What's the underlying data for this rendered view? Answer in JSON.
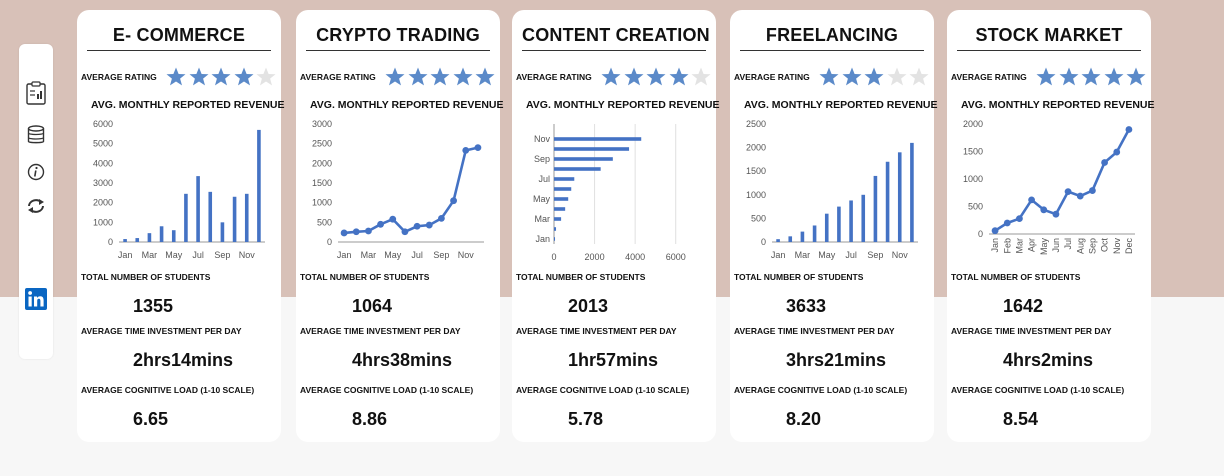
{
  "colors": {
    "accent": "#4472c4",
    "star_filled": "#5b8ac9",
    "star_empty": "#e3e3e3",
    "top_band": "#d8c1b8",
    "linkedin": "#0a66c2"
  },
  "sidebar": {
    "icons": [
      "clipboard-report-icon",
      "database-icon",
      "info-icon",
      "refresh-icon",
      "linkedin-icon"
    ]
  },
  "labels": {
    "rating": "AVERAGE RATING",
    "chart": "AVG. MONTHLY REPORTED REVENUE",
    "students": "TOTAL NUMBER OF STUDENTS",
    "time": "AVERAGE TIME INVESTMENT PER DAY",
    "cognitive": "AVERAGE COGNITIVE LOAD (1-10 SCALE)"
  },
  "cards": [
    {
      "title": "E- COMMERCE",
      "rating": 4,
      "students": "1355",
      "time": "2hrs14mins",
      "cognitive": "6.65"
    },
    {
      "title": "CRYPTO TRADING",
      "rating": 5,
      "students": "1064",
      "time": "4hrs38mins",
      "cognitive": "8.86"
    },
    {
      "title": "CONTENT CREATION",
      "rating": 4,
      "students": "2013",
      "time": "1hr57mins",
      "cognitive": "5.78"
    },
    {
      "title": "FREELANCING",
      "rating": 3,
      "students": "3633",
      "time": "3hrs21mins",
      "cognitive": "8.20"
    },
    {
      "title": "STOCK MARKET",
      "rating": 5,
      "students": "1642",
      "time": "4hrs2mins",
      "cognitive": "8.54"
    }
  ],
  "chart_data": [
    {
      "type": "bar",
      "title": "AVG. MONTHLY REPORTED REVENUE",
      "categories": [
        "Jan",
        "Feb",
        "Mar",
        "Apr",
        "May",
        "Jun",
        "Jul",
        "Aug",
        "Sep",
        "Oct",
        "Nov",
        "Dec"
      ],
      "tick_labels": [
        "Jan",
        "Mar",
        "May",
        "Jul",
        "Sep",
        "Nov"
      ],
      "values": [
        150,
        200,
        450,
        800,
        600,
        2450,
        3350,
        2550,
        1000,
        2300,
        2450,
        5700
      ],
      "ylim": [
        0,
        6000
      ],
      "yticks": [
        0,
        1000,
        2000,
        3000,
        4000,
        5000,
        6000
      ],
      "grid": false
    },
    {
      "type": "line",
      "title": "AVG. MONTHLY REPORTED REVENUE",
      "categories": [
        "Jan",
        "Feb",
        "Mar",
        "Apr",
        "May",
        "Jun",
        "Jul",
        "Aug",
        "Sep",
        "Oct",
        "Nov",
        "Dec"
      ],
      "tick_labels": [
        "Jan",
        "Mar",
        "May",
        "Jul",
        "Sep",
        "Nov"
      ],
      "values": [
        230,
        260,
        280,
        450,
        580,
        260,
        400,
        430,
        600,
        1050,
        2330,
        2400
      ],
      "ylim": [
        0,
        3000
      ],
      "yticks": [
        0,
        500,
        1000,
        1500,
        2000,
        2500,
        3000
      ],
      "grid": false
    },
    {
      "type": "bar",
      "orientation": "horizontal",
      "title": "AVG. MONTHLY REPORTED REVENUE",
      "categories": [
        "Jan",
        "Feb",
        "Mar",
        "Apr",
        "May",
        "Jun",
        "Jul",
        "Aug",
        "Sep",
        "Oct",
        "Nov",
        "Dec"
      ],
      "tick_labels": [
        "Jan",
        "Mar",
        "May",
        "Jul",
        "Sep",
        "Nov"
      ],
      "values": [
        50,
        100,
        350,
        550,
        700,
        850,
        1000,
        2300,
        2900,
        3700,
        4300,
        0
      ],
      "xlim": [
        0,
        7000
      ],
      "xticks": [
        0,
        2000,
        4000,
        6000
      ],
      "grid": true
    },
    {
      "type": "bar",
      "title": "AVG. MONTHLY REPORTED REVENUE",
      "categories": [
        "Jan",
        "Feb",
        "Mar",
        "Apr",
        "May",
        "Jun",
        "Jul",
        "Aug",
        "Sep",
        "Oct",
        "Nov",
        "Dec"
      ],
      "tick_labels": [
        "Jan",
        "Mar",
        "May",
        "Jul",
        "Sep",
        "Nov"
      ],
      "values": [
        60,
        120,
        220,
        350,
        600,
        750,
        880,
        1000,
        1400,
        1700,
        1900,
        2100
      ],
      "ylim": [
        0,
        2500
      ],
      "yticks": [
        0,
        500,
        1000,
        1500,
        2000,
        2500
      ],
      "grid": false
    },
    {
      "type": "line",
      "title": "AVG. MONTHLY REPORTED REVENUE",
      "categories": [
        "Jan",
        "Feb",
        "Mar",
        "Apr",
        "May",
        "Jun",
        "Jul",
        "Aug",
        "Sep",
        "Oct",
        "Nov",
        "Dec"
      ],
      "tick_labels": [
        "Jan",
        "Feb",
        "Mar",
        "Apr",
        "May",
        "Jun",
        "Jul",
        "Aug",
        "Sep",
        "Oct",
        "Nov",
        "Dec"
      ],
      "values": [
        60,
        200,
        280,
        620,
        440,
        360,
        770,
        690,
        790,
        1300,
        1490,
        1900
      ],
      "ylim": [
        0,
        2000
      ],
      "yticks": [
        0,
        500,
        1000,
        1500,
        2000
      ],
      "grid": false
    }
  ]
}
